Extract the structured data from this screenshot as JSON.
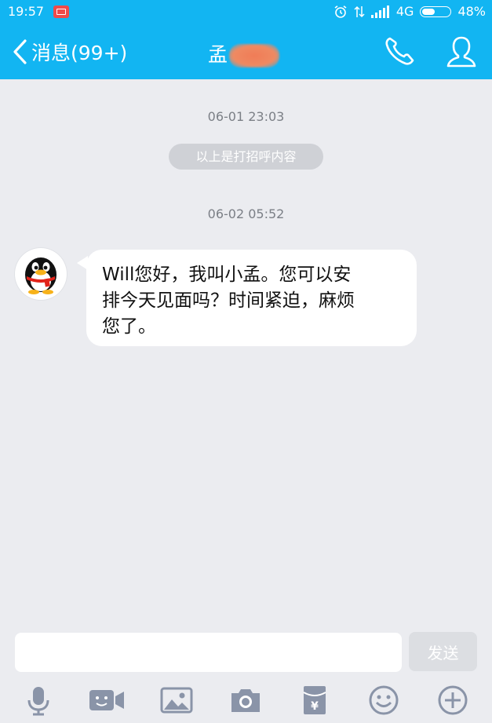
{
  "status_bar": {
    "time": "19:57",
    "network": "4G",
    "battery": "48%",
    "battery_level": 0.48
  },
  "header": {
    "back_label": "消息(99+)",
    "title": "孟"
  },
  "messages": {
    "timestamp_1": "06-01 23:03",
    "system_notice": "以上是打招呼内容",
    "timestamp_2": "06-02 05:52",
    "bubble_lines": [
      "Will您好，我叫小孟。您可以安",
      "排今天见面吗？时间紧迫，麻烦",
      "您了。"
    ]
  },
  "input_bar": {
    "text": "",
    "send_label": "发送"
  },
  "toolbar": {
    "icons": [
      "microphone-icon",
      "video-icon",
      "image-icon",
      "camera-icon",
      "red-packet-icon",
      "emoji-icon",
      "plus-icon"
    ],
    "red_packet_symbol": "¥"
  },
  "colors": {
    "accent": "#12b5f2",
    "background": "#ebecf0",
    "icon": "#8a94a8"
  }
}
